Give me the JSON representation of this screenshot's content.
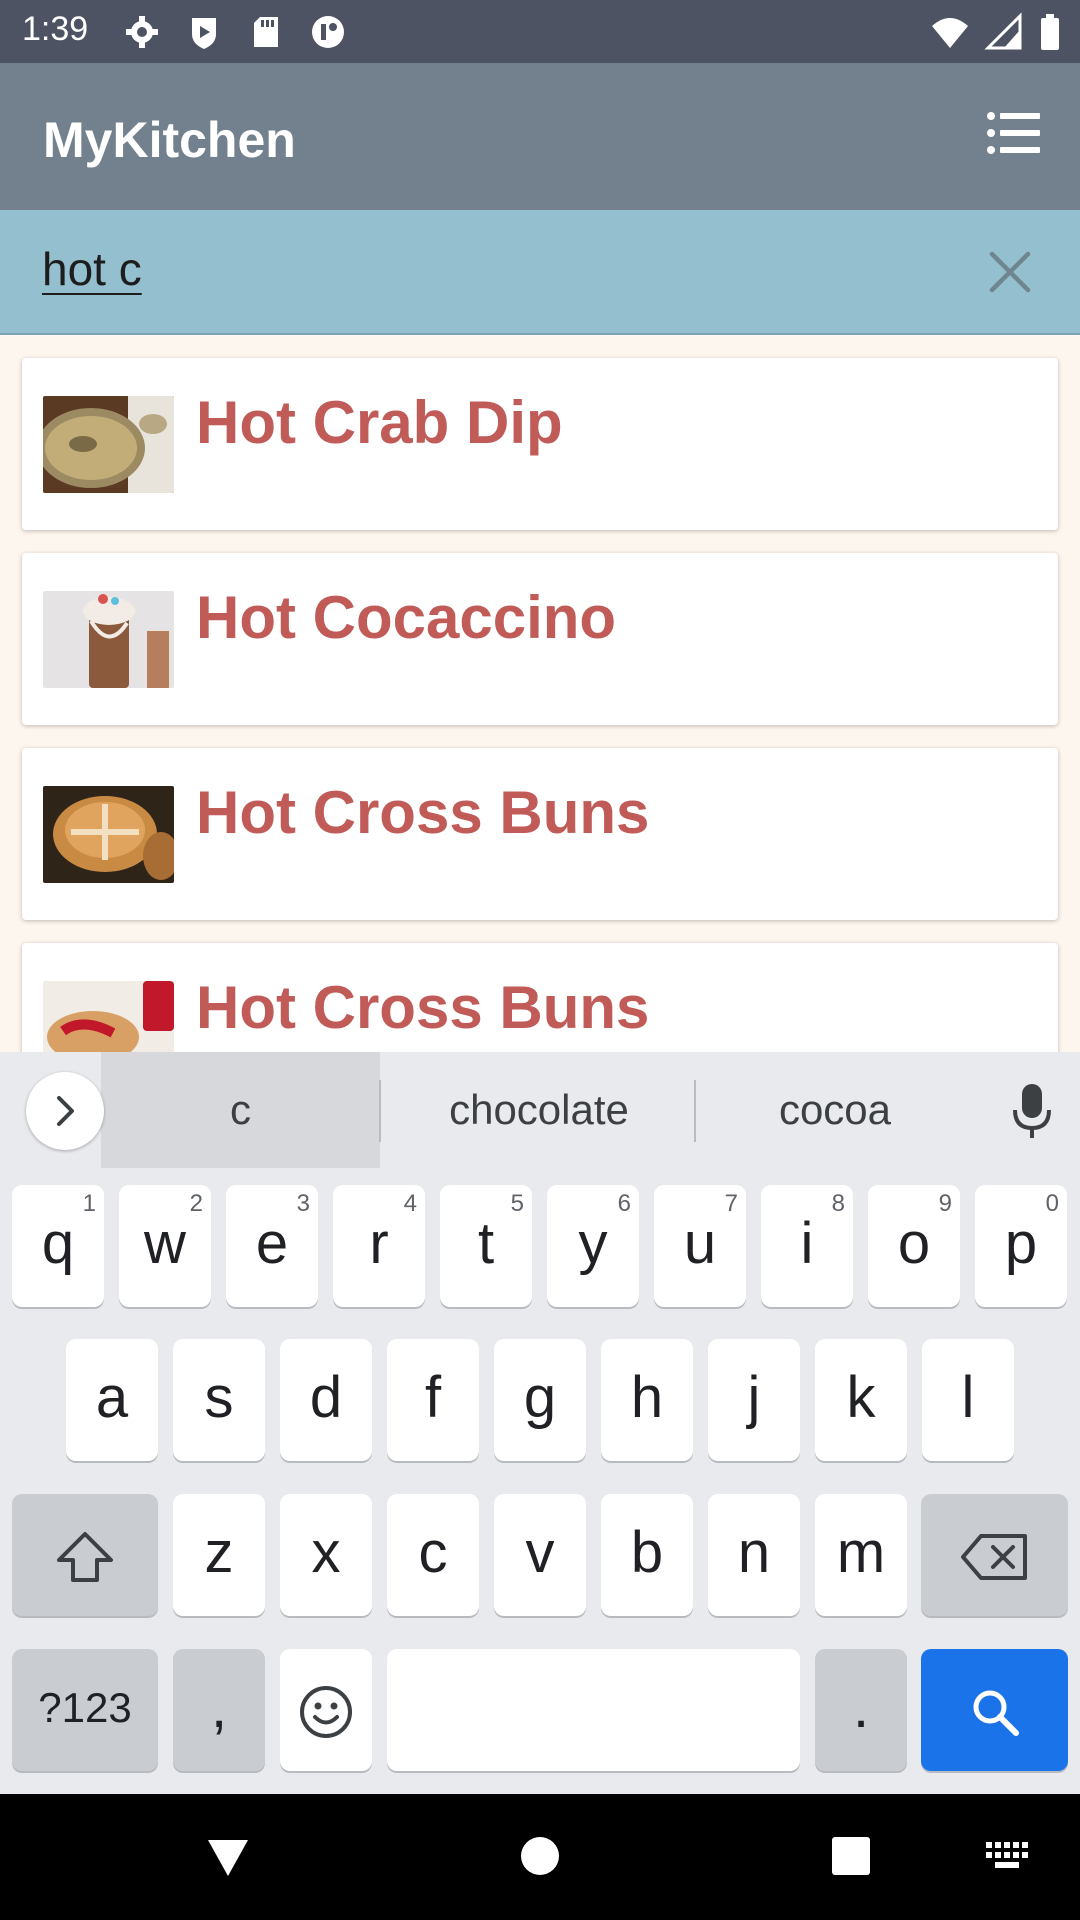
{
  "status_bar": {
    "time": "1:39",
    "left_icons": [
      "settings-icon",
      "shield-icon",
      "sd-card-icon",
      "app-icon"
    ],
    "right_icons": [
      "wifi-icon",
      "signal-icon",
      "battery-icon"
    ]
  },
  "app_bar": {
    "title": "MyKitchen",
    "menu_icon": "list-menu-icon",
    "color": "#73808d"
  },
  "search": {
    "value": "hot c",
    "clear_icon": "close-icon",
    "color": "#93bfcf"
  },
  "results": [
    {
      "title": "Hot Crab Dip",
      "thumb": "crab-dip-photo"
    },
    {
      "title": "Hot Cocaccino",
      "thumb": "cocaccino-photo"
    },
    {
      "title": "Hot Cross Buns",
      "thumb": "cross-buns-photo"
    },
    {
      "title": "Hot Cross Buns",
      "thumb": "cross-buns-jam-photo"
    }
  ],
  "keyboard": {
    "suggestions": [
      "c",
      "chocolate",
      "cocoa"
    ],
    "row1": [
      {
        "k": "q",
        "h": "1"
      },
      {
        "k": "w",
        "h": "2"
      },
      {
        "k": "e",
        "h": "3"
      },
      {
        "k": "r",
        "h": "4"
      },
      {
        "k": "t",
        "h": "5"
      },
      {
        "k": "y",
        "h": "6"
      },
      {
        "k": "u",
        "h": "7"
      },
      {
        "k": "i",
        "h": "8"
      },
      {
        "k": "o",
        "h": "9"
      },
      {
        "k": "p",
        "h": "0"
      }
    ],
    "row2": [
      "a",
      "s",
      "d",
      "f",
      "g",
      "h",
      "j",
      "k",
      "l"
    ],
    "row3": [
      "z",
      "x",
      "c",
      "v",
      "b",
      "n",
      "m"
    ],
    "symbols_label": "?123",
    "comma": ",",
    "period": ".",
    "accent_color": "#1a73e8"
  },
  "nav_bar": {
    "icons": [
      "back-icon",
      "home-icon",
      "recents-icon",
      "keyboard-icon"
    ]
  }
}
